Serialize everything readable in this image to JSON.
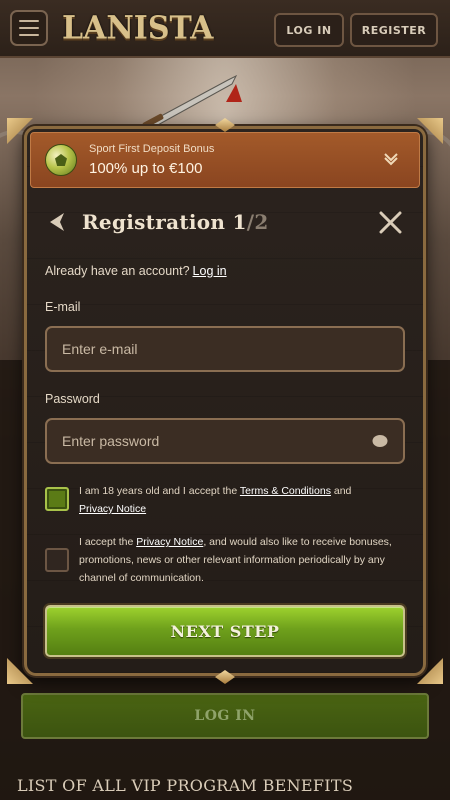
{
  "header": {
    "logo": "LANISTA",
    "login_label": "LOG IN",
    "register_label": "REGISTER"
  },
  "bonus": {
    "subtitle": "Sport First Deposit Bonus",
    "title": "100% up to €100",
    "icon": "soccer-ball-icon"
  },
  "registration": {
    "title_main": "Registration 1",
    "title_suffix": "/2",
    "have_account": "Already have an account?",
    "login_link": "Log in",
    "email_label": "E-mail",
    "email_placeholder": "Enter e-mail",
    "email_value": "",
    "password_label": "Password",
    "password_placeholder": "Enter password",
    "password_value": "",
    "terms_checked": true,
    "terms_pre": "I am 18 years old and I accept the ",
    "terms_link": "Terms & Conditions",
    "terms_mid": " and ",
    "privacy_link": "Privacy Notice",
    "marketing_checked": false,
    "marketing_pre": "I accept the ",
    "marketing_link": "Privacy Notice",
    "marketing_post": ", and would also like to receive bonuses, promotions, news or other relevant information periodically by any channel of communication.",
    "next_label": "NEXT STEP"
  },
  "page": {
    "login_button": "LOG IN",
    "vip_heading": "LIST OF ALL VIP PROGRAM BENEFITS"
  },
  "colors": {
    "accent_green": "#6fa11c",
    "bonus_orange": "#a35a2a",
    "gold_frame": "#8a6a3f",
    "background": "#2a1f18"
  }
}
